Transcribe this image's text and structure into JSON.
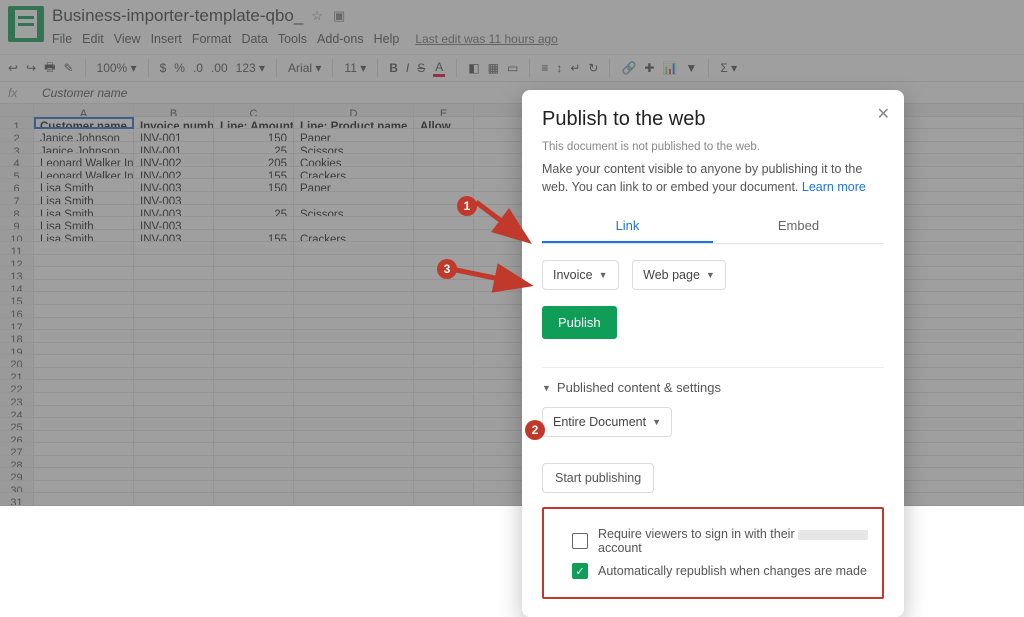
{
  "app": {
    "logo": "google-sheets"
  },
  "doc": {
    "title": "Business-importer-template-qbo_",
    "menus": [
      "File",
      "Edit",
      "View",
      "Insert",
      "Format",
      "Data",
      "Tools",
      "Add-ons",
      "Help"
    ],
    "last_edit": "Last edit was 11 hours ago",
    "star_icon": "☆",
    "folder_icon": "▣"
  },
  "toolbar": {
    "zoom": "100%",
    "currency": "$",
    "percent": "%",
    "dec0": ".0",
    "dec00": ".00",
    "fmt": "123",
    "font": "Arial",
    "size": "11",
    "strike": "S"
  },
  "formula_bar": {
    "active_cell": "Customer name"
  },
  "grid": {
    "col_letters": [
      "A",
      "B",
      "C",
      "D",
      "E"
    ],
    "headers": [
      "Customer name",
      "Invoice number",
      "Line: Amount",
      "Line: Product name",
      "Allow"
    ],
    "rows": [
      {
        "n": 2,
        "c": [
          "Janice Johnson",
          "INV-001",
          "150",
          "Paper",
          ""
        ]
      },
      {
        "n": 3,
        "c": [
          "Janice Johnson",
          "INV-001",
          "25",
          "Scissors",
          ""
        ]
      },
      {
        "n": 4,
        "c": [
          "Leonard Walker Inc",
          "INV-002",
          "205",
          "Cookies",
          ""
        ]
      },
      {
        "n": 5,
        "c": [
          "Leonard Walker Inc",
          "INV-002",
          "155",
          "Crackers",
          ""
        ]
      },
      {
        "n": 6,
        "c": [
          "Lisa Smith",
          "INV-003",
          "150",
          "Paper",
          ""
        ]
      },
      {
        "n": 7,
        "c": [
          "Lisa Smith",
          "INV-003",
          "",
          "",
          ""
        ]
      },
      {
        "n": 8,
        "c": [
          "Lisa Smith",
          "INV-003",
          "25",
          "Scissors",
          ""
        ]
      },
      {
        "n": 9,
        "c": [
          "Lisa Smith",
          "INV-003",
          "",
          "",
          ""
        ]
      },
      {
        "n": 10,
        "c": [
          "Lisa Smith",
          "INV-003",
          "155",
          "Crackers",
          ""
        ]
      }
    ],
    "empty_rows": 21
  },
  "modal": {
    "title": "Publish to the web",
    "note": "This document is not published to the web.",
    "desc": "Make your content visible to anyone by publishing it to the web. You can link to or embed your document.",
    "learn_more": "Learn more",
    "tabs": {
      "link": "Link",
      "embed": "Embed",
      "active": "link"
    },
    "sheet_select": "Invoice",
    "format_select": "Web page",
    "publish_btn": "Publish",
    "accordion": "Published content & settings",
    "doc_select": "Entire Document",
    "start_pub": "Start publishing",
    "opt_signin_pre": "Require viewers to sign in with their",
    "opt_signin_post": "account",
    "opt_autorepub": "Automatically republish when changes are made"
  },
  "annotations": {
    "b1": "1",
    "b2": "2",
    "b3": "3"
  }
}
